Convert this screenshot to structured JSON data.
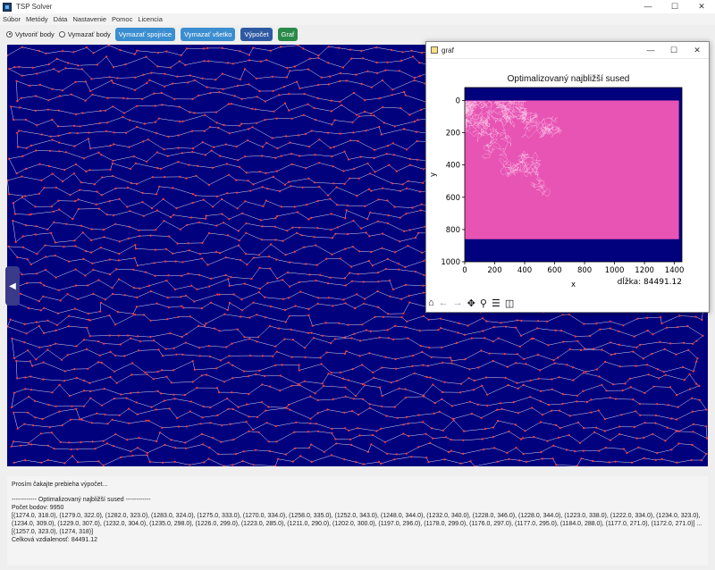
{
  "window": {
    "title": "TSP Solver",
    "controls": [
      "—",
      "☐",
      "✕"
    ]
  },
  "menu": {
    "items": [
      "Súbor",
      "Metódy",
      "Dáta",
      "Nastavenie",
      "Pomoc",
      "Licencia"
    ]
  },
  "toolbar": {
    "radio_create": "Vytvoriť body",
    "radio_delete": "Vymazať body",
    "btn_clear_links": "Vymazať spojnice",
    "btn_clear_all": "Vymazať všetko",
    "btn_compute": "Výpočet",
    "btn_graph": "Graf"
  },
  "canvas": {
    "background": "#01017e",
    "edge_color": "#ffffff",
    "point_color": "#ff3b3b",
    "side_toggle": "◀"
  },
  "graph_window": {
    "title": "graf",
    "controls": [
      "—",
      "☐",
      "✕"
    ],
    "length_label": "dĺžka: 84491.12",
    "toolbar_icons": [
      "home-icon",
      "back-icon",
      "forward-icon",
      "pan-icon",
      "zoom-icon",
      "configure-icon",
      "save-icon"
    ]
  },
  "chart_data": {
    "type": "scatter",
    "title": "Optimalizovaný najbližší sused",
    "xlabel": "x",
    "ylabel": "y",
    "xlim": [
      0,
      1450
    ],
    "ylim": [
      1000,
      -80
    ],
    "xticks": [
      0,
      200,
      400,
      600,
      800,
      1000,
      1200,
      1400
    ],
    "yticks": [
      0,
      200,
      400,
      600,
      800,
      1000
    ],
    "point_region": {
      "x": [
        0,
        1430
      ],
      "y": [
        0,
        860
      ]
    },
    "background": "#01017e",
    "fill_color": "#e754b4"
  },
  "console": {
    "line1": "Prosím čakajte prebieha výpočet...",
    "line2": "------------ Optimalizovaný najbližší sused ------------",
    "line3": "Počet bodov: 9950",
    "line4": "[(1274.0, 318.0), (1279.0, 322.0), (1282.0, 323.0), (1283.0, 324.0), (1275.0, 333.0), (1270.0, 334.0), (1258.0, 335.0), (1252.0, 343.0), (1248.0, 344.0), (1232.0, 340.0), (1228.0, 346.0), (1228.0, 344.0), (1223.0, 338.0), (1222.0, 334.0), (1234.0, 323.0), (1234.0, 309.0), (1229.0, 307.0), (1232.0, 304.0), (1235.0, 298.0), (1226.0, 299.0), (1223.0, 285.0), (1211.0, 290.0), (1202.0, 300.0), (1197.0, 296.0), (1178.0, 299.0), (1176.0, 297.0), (1177.0, 295.0), (1184.0, 288.0), (1177.0, 271.0), (1172.0, 271.0)] ... [(1257.0, 323.0), (1274, 318)]",
    "line5": "Celková vzdialenosť: 84491.12"
  }
}
